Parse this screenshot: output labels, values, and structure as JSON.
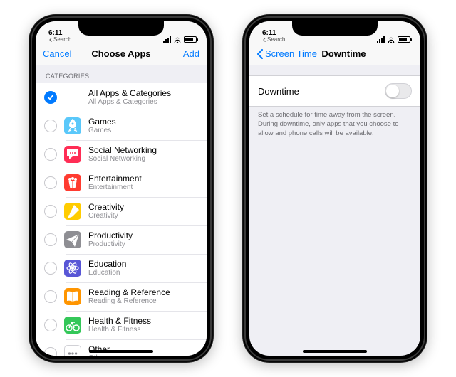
{
  "status": {
    "time": "6:11",
    "back_app_label": "Search"
  },
  "phone1": {
    "nav": {
      "left": "Cancel",
      "title": "Choose Apps",
      "right": "Add"
    },
    "section_header": "Categories",
    "categories": [
      {
        "title": "All Apps & Categories",
        "subtitle": "All Apps & Categories",
        "checked": true,
        "icon": "none",
        "bg": "transparent"
      },
      {
        "title": "Games",
        "subtitle": "Games",
        "checked": false,
        "icon": "rocket",
        "bg": "#5ac8fa"
      },
      {
        "title": "Social Networking",
        "subtitle": "Social Networking",
        "checked": false,
        "icon": "chat",
        "bg": "#ff2d55"
      },
      {
        "title": "Entertainment",
        "subtitle": "Entertainment",
        "checked": false,
        "icon": "popcorn",
        "bg": "#ff3b30"
      },
      {
        "title": "Creativity",
        "subtitle": "Creativity",
        "checked": false,
        "icon": "brush",
        "bg": "#ffcc00"
      },
      {
        "title": "Productivity",
        "subtitle": "Productivity",
        "checked": false,
        "icon": "paperplane",
        "bg": "#8e8e93"
      },
      {
        "title": "Education",
        "subtitle": "Education",
        "checked": false,
        "icon": "atom",
        "bg": "#5856d6"
      },
      {
        "title": "Reading & Reference",
        "subtitle": "Reading & Reference",
        "checked": false,
        "icon": "book",
        "bg": "#ff9500"
      },
      {
        "title": "Health & Fitness",
        "subtitle": "Health & Fitness",
        "checked": false,
        "icon": "bike",
        "bg": "#34c759"
      },
      {
        "title": "Other",
        "subtitle": "Other",
        "checked": false,
        "icon": "dots",
        "bg": "#8e8e93"
      }
    ]
  },
  "phone2": {
    "nav": {
      "back": "Screen Time",
      "title": "Downtime"
    },
    "toggle": {
      "label": "Downtime",
      "on": false
    },
    "footer": "Set a schedule for time away from the screen. During downtime, only apps that you choose to allow and phone calls will be available."
  }
}
